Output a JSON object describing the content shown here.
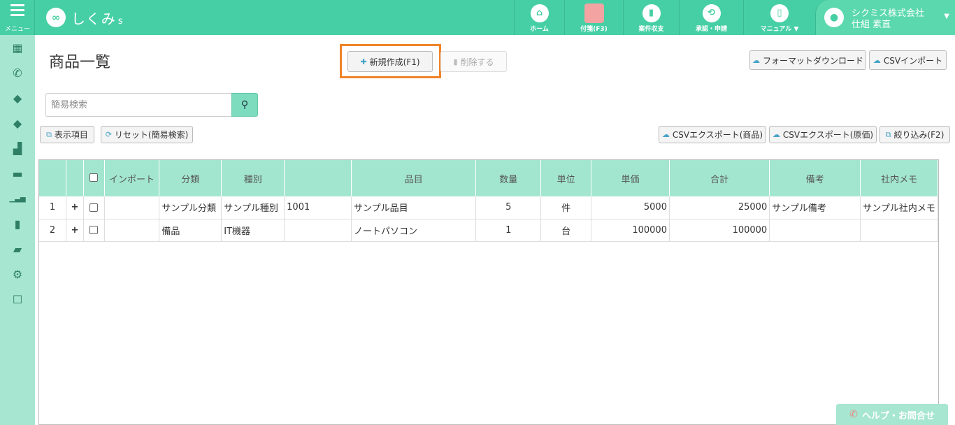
{
  "topbar": {
    "menu_label": "メニュー",
    "brand": "しくみ",
    "brand_suffix": "s",
    "nav": [
      {
        "label": "ホーム",
        "icon": "home-icon",
        "glyph": "⌂"
      },
      {
        "label": "付箋(F3)",
        "icon": "sticky-note-icon",
        "glyph": ""
      },
      {
        "label": "案件収支",
        "icon": "bar-chart-icon",
        "glyph": "▮"
      },
      {
        "label": "承認・申請",
        "icon": "retweet-icon",
        "glyph": "⟲"
      },
      {
        "label": "マニュアル ▼",
        "icon": "book-icon",
        "glyph": "▯"
      }
    ],
    "user": {
      "company": "シクミス株式会社",
      "name": "仕組 素直"
    }
  },
  "sidebar": {
    "icons": [
      {
        "name": "calendar-icon",
        "glyph": "▦"
      },
      {
        "name": "phone-icon",
        "glyph": "✆"
      },
      {
        "name": "tag-icon",
        "glyph": "◆"
      },
      {
        "name": "tags-icon",
        "glyph": "◆"
      },
      {
        "name": "bar-chart-icon",
        "glyph": "▟"
      },
      {
        "name": "credit-card-icon",
        "glyph": "▬"
      },
      {
        "name": "signal-icon",
        "glyph": "▁▃▅"
      },
      {
        "name": "file-icon",
        "glyph": "▮"
      },
      {
        "name": "folder-open-icon",
        "glyph": "▰"
      },
      {
        "name": "gear-icon",
        "glyph": "⚙"
      },
      {
        "name": "checkbox-icon",
        "glyph": "☐"
      }
    ]
  },
  "page": {
    "title": "商品一覧"
  },
  "toolbar": {
    "new_label": "新規作成(F1)",
    "delete_label": "削除する",
    "format_download_label": "フォーマットダウンロード",
    "csv_import_label": "CSVインポート",
    "display_items_label": "表示項目",
    "reset_label": "リセット(簡易検索)",
    "csv_export_product_label": "CSVエクスポート(商品)",
    "csv_export_cost_label": "CSVエクスポート(原価)",
    "filter_label": "絞り込み(F2)"
  },
  "search": {
    "placeholder": "簡易検索",
    "value": ""
  },
  "table": {
    "columns": [
      "",
      "",
      "",
      "インポート",
      "分類",
      "種別",
      "",
      "品目",
      "数量",
      "単位",
      "単価",
      "合計",
      "備考",
      "社内メモ"
    ],
    "rows": [
      [
        "1",
        "+",
        "",
        "",
        "サンプル分類",
        "サンプル種別",
        "1001",
        "サンプル品目",
        "5",
        "件",
        "5000",
        "25000",
        "サンプル備考",
        "サンプル社内メモ"
      ],
      [
        "2",
        "+",
        "",
        "",
        "備品",
        "IT機器",
        "",
        "ノートパソコン",
        "1",
        "台",
        "100000",
        "100000",
        "",
        ""
      ]
    ]
  },
  "help": {
    "label": "ヘルプ・お問合せ"
  },
  "colors": {
    "accent": "#46cfa4",
    "sidebar": "#a7e6d1",
    "header_row": "#a3e6cf",
    "highlight": "#f08428"
  }
}
